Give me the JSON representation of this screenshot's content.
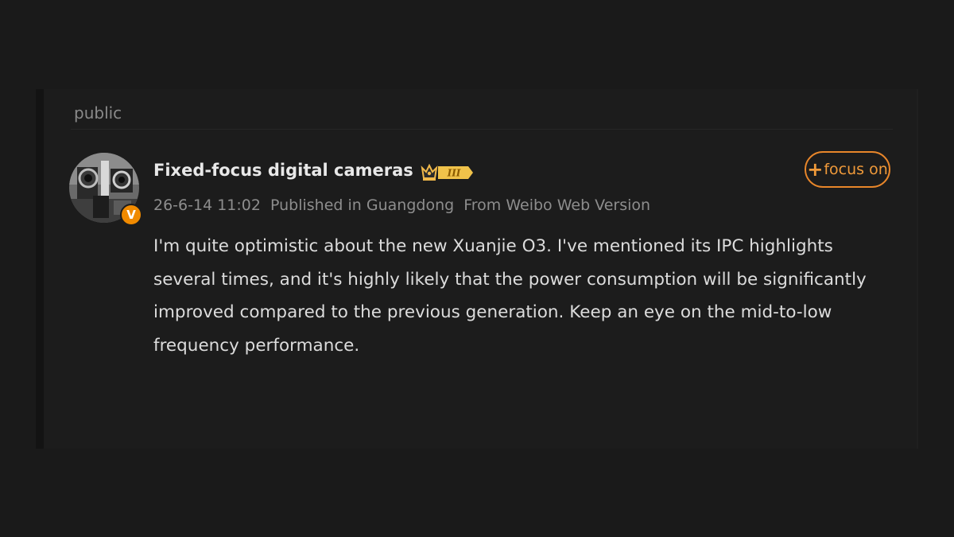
{
  "post": {
    "visibility": "public",
    "author": {
      "name": "Fixed-focus digital cameras",
      "verified_mark": "V",
      "level_badge": "III"
    },
    "meta": {
      "timestamp": "26-6-14 11:02",
      "location": "Published in Guangdong",
      "source": "From Weibo Web Version"
    },
    "follow_button": {
      "icon": "+",
      "label": "focus on"
    },
    "content": "I'm quite optimistic about the new Xuanjie O3. I've mentioned its IPC highlights several times, and it's highly likely that the power consumption will be significantly improved compared to the previous generation. Keep an eye on the mid-to-low frequency performance.",
    "colors": {
      "accent": "#e8862a",
      "background": "#1a1a1a",
      "text": "#dcdcdc",
      "muted": "#8d8d8d"
    }
  }
}
